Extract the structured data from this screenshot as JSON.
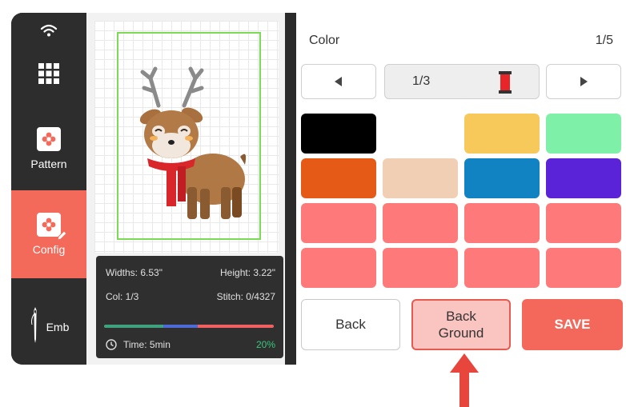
{
  "sidebar": {
    "items": [
      {
        "label": "Pattern",
        "icon": "flower-icon"
      },
      {
        "label": "Config",
        "icon": "flower-edit-icon"
      },
      {
        "label": "Emb",
        "icon": "needle-icon"
      }
    ],
    "active_color": "#f46a5a"
  },
  "design_info": {
    "widths_label": "Widths: 6.53\"",
    "height_label": "Height: 3.22\"",
    "col_label": "Col: 1/3",
    "stitch_label": "Stitch: 0/4327",
    "time_label": "Time: 5min",
    "percent_label": "20%",
    "progress": 0.2
  },
  "color_panel": {
    "title": "Color",
    "page": "1/5",
    "thread_page": "1/3",
    "swatches": [
      "#000000",
      "",
      "#f7c85a",
      "#7ff0a7",
      "#e65a17",
      "#f0cfb4",
      "#1283c2",
      "#5a23d8",
      "#fe7a7a",
      "#fe7a7a",
      "#fe7a7a",
      "#fe7a7a",
      "#fe7a7a",
      "#fe7a7a",
      "#fe7a7a",
      "#fe7a7a"
    ]
  },
  "buttons": {
    "back": "Back",
    "background_line1": "Back",
    "background_line2": "Ground",
    "save": "SAVE"
  },
  "colors": {
    "accent": "#f46a5a",
    "arrow": "#e8453c"
  }
}
